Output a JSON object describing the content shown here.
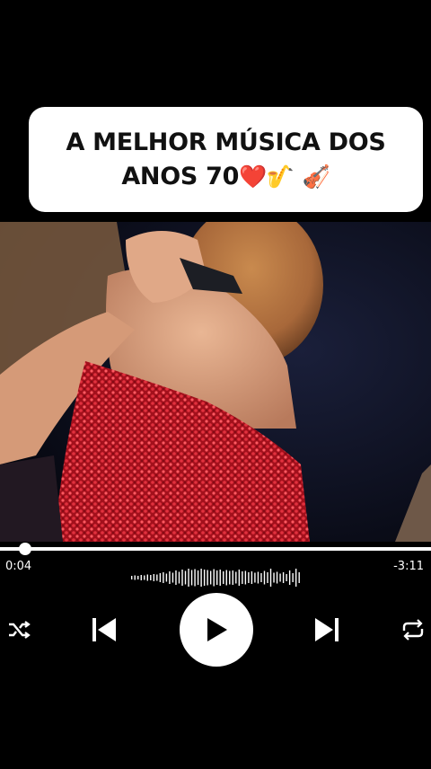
{
  "caption": {
    "text": "A MELHOR MÚSICA DOS ANOS 70",
    "emojis": [
      "❤️",
      "🎷",
      "🎻"
    ]
  },
  "video": {
    "description_icon": "video-frame"
  },
  "player": {
    "elapsed": "0:04",
    "remaining": "-3:11",
    "progress": 0.021,
    "controls": {
      "shuffle_icon": "shuffle-icon",
      "previous_icon": "skip-previous-icon",
      "play_icon": "play-icon",
      "next_icon": "skip-next-icon",
      "repeat_icon": "repeat-icon"
    }
  }
}
